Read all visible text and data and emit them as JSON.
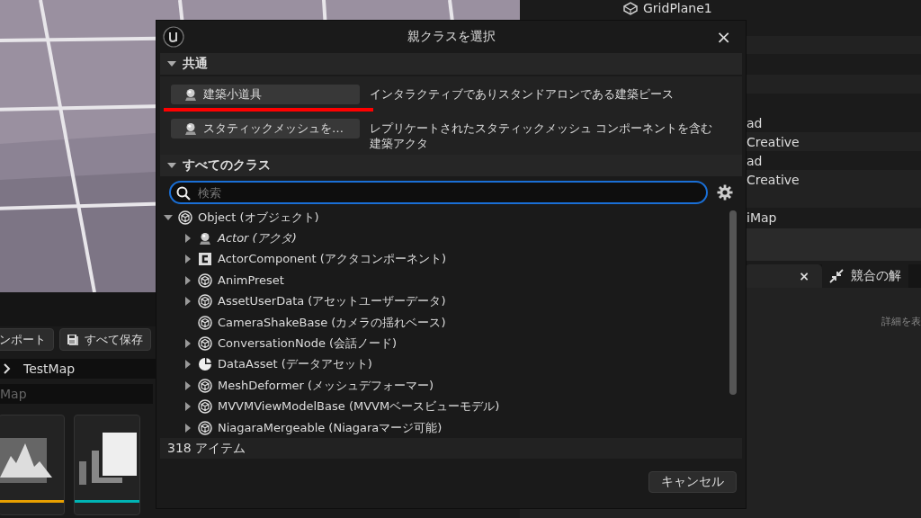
{
  "editor": {
    "toolbar": [
      {
        "label": "ンポート",
        "kind": "plain"
      },
      {
        "label": "すべて保存",
        "kind": "save"
      }
    ],
    "path_bar": {
      "crumb": "TestMap"
    },
    "asset_search": {
      "value": "Map"
    },
    "thumbnails": [
      {
        "kind": "landscape",
        "color": "#e8a000"
      },
      {
        "kind": "layers",
        "color": "#00b4b4"
      }
    ]
  },
  "outliner": {
    "top_item": {
      "label": "GridPlane1"
    },
    "row_groups": [
      [
        {
          "label": "ad"
        },
        {
          "label": "Creative"
        },
        {
          "label": "ad"
        },
        {
          "label": "Creative"
        }
      ],
      [
        {
          "label": "iMap"
        }
      ]
    ]
  },
  "details": {
    "tabs": [
      {
        "close": "×",
        "selected": true
      },
      {
        "label": "競合の解",
        "selected": false
      }
    ],
    "hint": "詳細を表"
  },
  "dialog": {
    "title": "親クラスを選択",
    "close": "×",
    "sections": [
      {
        "kind": "common",
        "title": "共通",
        "expanded": true
      },
      {
        "kind": "classes",
        "title": "すべてのクラス",
        "expanded": true
      }
    ],
    "common_items": [
      {
        "label": "建築小道具",
        "description": "インタラクティブでありスタンドアロンである建築ピース",
        "highlighted": true
      },
      {
        "label": "スタティックメッシュを…",
        "description": "レプリケートされたスタティックメッシュ コンポーネントを含む建築アクタ",
        "highlighted": false
      }
    ],
    "search": {
      "placeholder": "検索"
    },
    "tree": [
      {
        "label": "Object (オブジェクト)",
        "kind": "cube",
        "expandable": true,
        "expanded": true,
        "italic": false,
        "children": [
          {
            "label": "Actor (アクタ)",
            "kind": "actor",
            "expandable": true,
            "expanded": false,
            "italic": true
          },
          {
            "label": "ActorComponent (アクタコンポーネント)",
            "kind": "component",
            "expandable": true,
            "expanded": false,
            "italic": false
          },
          {
            "label": "AnimPreset",
            "kind": "cube",
            "expandable": true,
            "expanded": false,
            "italic": false
          },
          {
            "label": "AssetUserData (アセットユーザーデータ)",
            "kind": "cube",
            "expandable": true,
            "expanded": false,
            "italic": false
          },
          {
            "label": "CameraShakeBase (カメラの揺れベース)",
            "kind": "cube",
            "expandable": false,
            "expanded": false,
            "italic": false
          },
          {
            "label": "ConversationNode (会話ノード)",
            "kind": "cube",
            "expandable": true,
            "expanded": false,
            "italic": false
          },
          {
            "label": "DataAsset (データアセット)",
            "kind": "pie",
            "expandable": true,
            "expanded": false,
            "italic": false
          },
          {
            "label": "MeshDeformer (メッシュデフォーマー)",
            "kind": "cube",
            "expandable": true,
            "expanded": false,
            "italic": false
          },
          {
            "label": "MVVMViewModelBase (MVVMベースビューモデル)",
            "kind": "cube",
            "expandable": true,
            "expanded": false,
            "italic": false
          },
          {
            "label": "NiagaraMergeable (Niagaraマージ可能)",
            "kind": "cube",
            "expandable": true,
            "expanded": false,
            "italic": false
          }
        ]
      }
    ],
    "count": "318 アイテム",
    "buttons": [
      {
        "label": "キャンセル"
      }
    ]
  }
}
